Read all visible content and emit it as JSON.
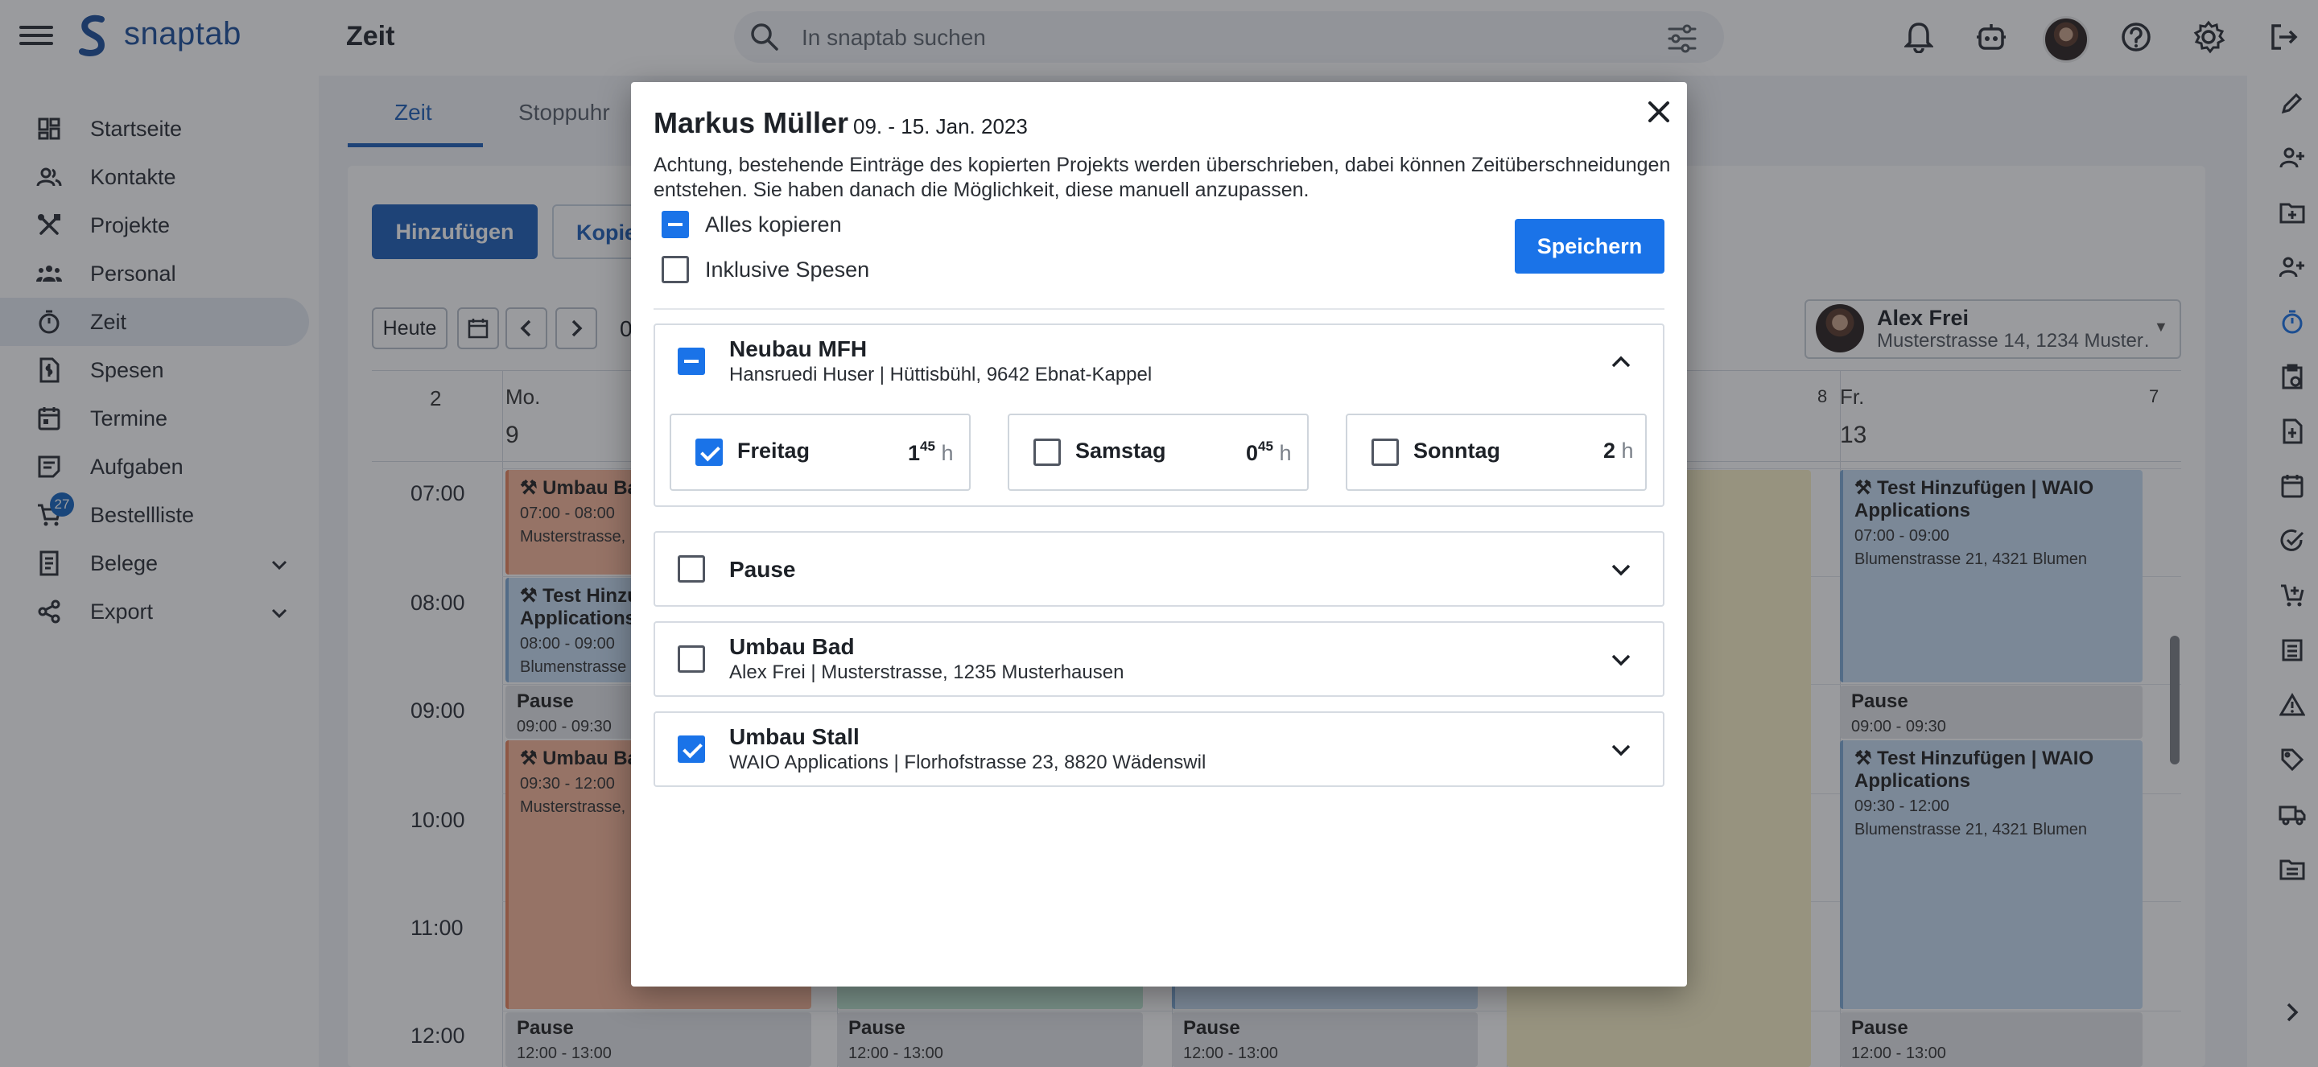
{
  "app": {
    "name": "snaptab",
    "page_title": "Zeit"
  },
  "search": {
    "placeholder": "In snaptab suchen"
  },
  "sidebar": {
    "items": [
      {
        "label": "Startseite",
        "icon": "dashboard-icon"
      },
      {
        "label": "Kontakte",
        "icon": "contacts-icon"
      },
      {
        "label": "Projekte",
        "icon": "tools-icon"
      },
      {
        "label": "Personal",
        "icon": "people-icon"
      },
      {
        "label": "Zeit",
        "icon": "timer-icon",
        "active": true
      },
      {
        "label": "Spesen",
        "icon": "receipt-icon"
      },
      {
        "label": "Termine",
        "icon": "calendar-icon"
      },
      {
        "label": "Aufgaben",
        "icon": "tasks-icon"
      },
      {
        "label": "Bestellliste",
        "icon": "cart-icon",
        "badge": "27"
      },
      {
        "label": "Belege",
        "icon": "document-icon",
        "expandable": true
      },
      {
        "label": "Export",
        "icon": "share-icon",
        "expandable": true
      }
    ]
  },
  "main": {
    "tabs": [
      "Zeit",
      "Stoppuhr"
    ],
    "add_button": "Hinzufügen",
    "copy_button": "Kopie",
    "today_button": "Heute",
    "week_num": "0",
    "person": {
      "name": "Alex Frei",
      "address": "Musterstrasse 14, 1234 Muster…"
    },
    "calendar": {
      "kw_left": "2",
      "kw_right_a": "8",
      "kw_right_b": "7",
      "day_mo_label": "Mo.",
      "day_mo_num": "9",
      "day_fr_label": "Fr.",
      "day_fr_num": "13",
      "times": [
        "07:00",
        "08:00",
        "09:00",
        "10:00",
        "11:00",
        "12:00"
      ],
      "events": {
        "mo_umbau_1": {
          "title": "Umbau Ba",
          "time": "07:00 - 08:00",
          "addr": "Musterstrasse,"
        },
        "mo_test": {
          "title": "Test Hinzu",
          "title2": "Applications",
          "time": "08:00 - 09:00",
          "addr": "Blumenstrasse"
        },
        "mo_pause": {
          "title": "Pause",
          "time": "09:00 - 09:30"
        },
        "mo_umbau_2": {
          "title": "Umbau Ba",
          "time": "09:30 - 12:00",
          "addr": "Musterstrasse,"
        },
        "mo_pause_2": {
          "title": "Pause",
          "time": "12:00 - 13:00"
        },
        "tu_pause": {
          "title": "Pause",
          "time": "12:00 - 13:00"
        },
        "we_pause": {
          "title": "Pause",
          "time": "12:00 - 13:00"
        },
        "fr_test_1": {
          "title": "Test Hinzufügen | WAIO",
          "title2": "Applications",
          "time": "07:00 - 09:00",
          "addr": "Blumenstrasse 21, 4321 Blumen"
        },
        "fr_pause": {
          "title": "Pause",
          "time": "09:00 - 09:30"
        },
        "fr_test_2": {
          "title": "Test Hinzufügen | WAIO",
          "title2": "Applications",
          "time": "09:30 - 12:00",
          "addr": "Blumenstrasse 21, 4321 Blumen"
        },
        "fr_pause_2": {
          "title": "Pause",
          "time": "12:00 - 13:00"
        }
      }
    }
  },
  "modal": {
    "title": "Markus Müller",
    "date_range": "09. - 15. Jan. 2023",
    "warning": "Achtung, bestehende Einträge des kopierten Projekts werden überschrieben, dabei können Zeitüberschneidungen entstehen. Sie haben danach die Möglichkeit, diese manuell anzupassen.",
    "copy_all_label": "Alles kopieren",
    "include_expenses_label": "Inklusive Spesen",
    "save_button": "Speichern",
    "projects": [
      {
        "title": "Neubau MFH",
        "subtitle": "Hansruedi Huser | Hüttisbühl, 9642 Ebnat-Kappel",
        "state": "mixed",
        "expanded": true,
        "days": [
          {
            "name": "Freitag",
            "hours": "1",
            "minutes": "45",
            "unit": "h",
            "checked": true
          },
          {
            "name": "Samstag",
            "hours": "0",
            "minutes": "45",
            "unit": "h",
            "checked": false
          },
          {
            "name": "Sonntag",
            "hours": "2",
            "minutes": "",
            "unit": "h",
            "checked": false
          }
        ]
      },
      {
        "title": "Pause",
        "subtitle": "",
        "state": "unchecked",
        "expanded": false
      },
      {
        "title": "Umbau Bad",
        "subtitle": "Alex Frei | Musterstrasse, 1235 Musterhausen",
        "state": "unchecked",
        "expanded": false
      },
      {
        "title": "Umbau Stall",
        "subtitle": "WAIO Applications | Florhofstrasse 23, 8820 Wädenswil",
        "state": "checked",
        "expanded": false
      }
    ]
  },
  "colors": {
    "primary": "#1a73e8",
    "brand": "#1d4f9c",
    "event_orange": "#f7b79a",
    "event_blue": "#c7dcf2",
    "event_green": "#bfe7d4",
    "event_yellow": "#faf1c7"
  }
}
